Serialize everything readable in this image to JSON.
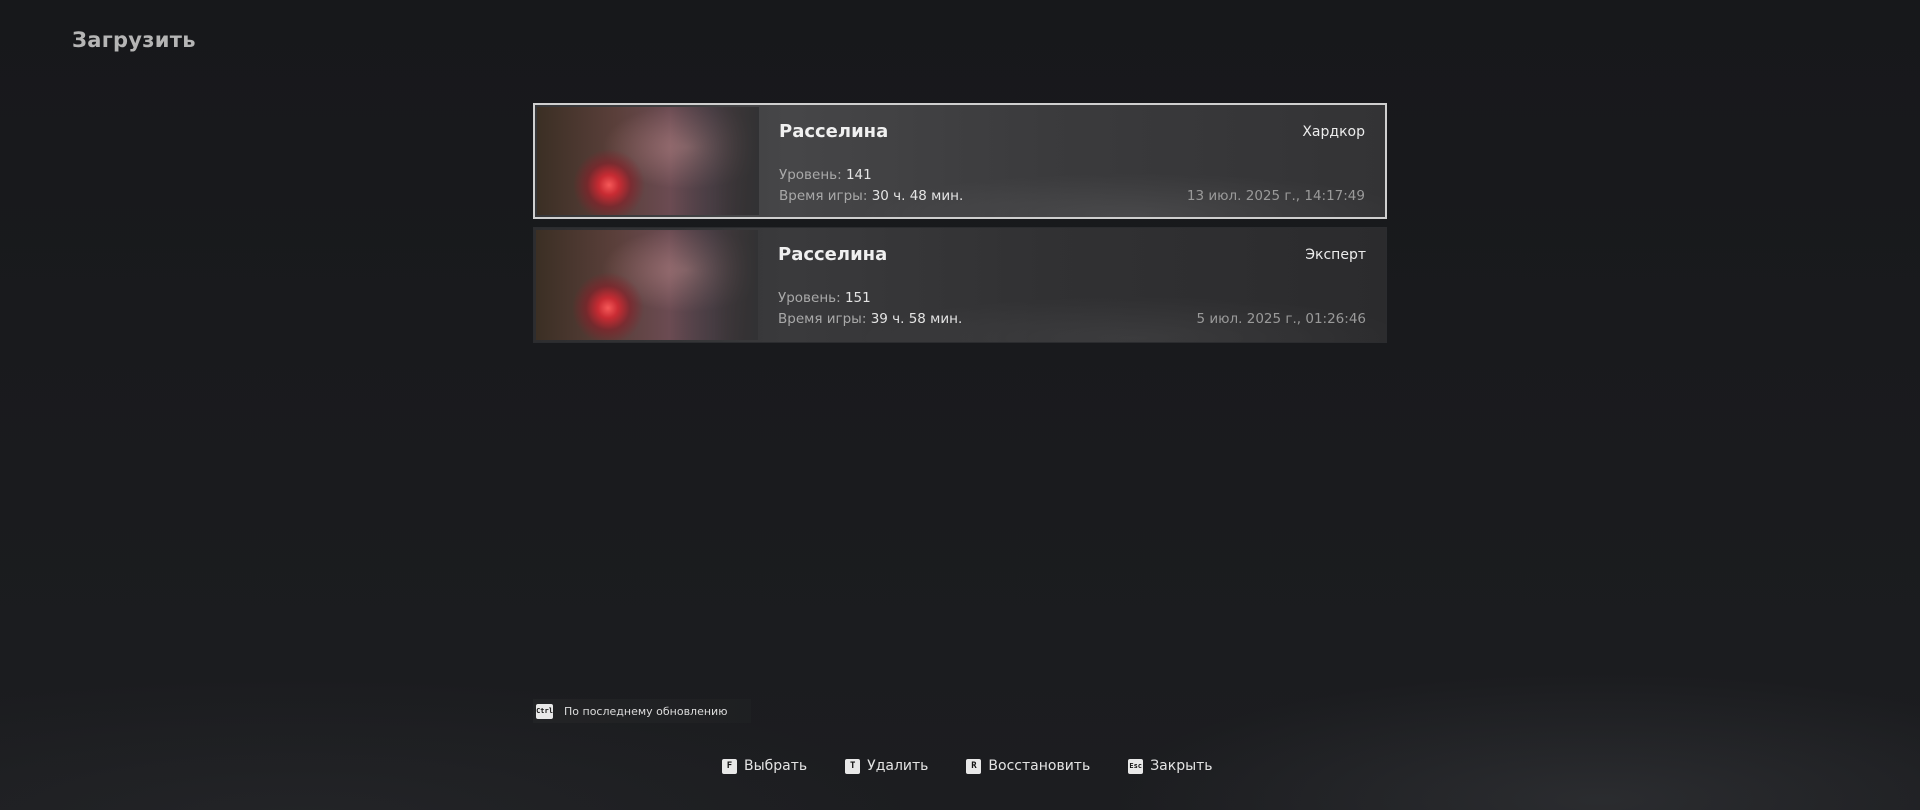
{
  "page": {
    "title": "Загрузить"
  },
  "saves": [
    {
      "name": "Расселина",
      "mode": "Хардкор",
      "level_label": "Уровень:",
      "level_value": "141",
      "time_label": "Время игры:",
      "time_value": "30 ч. 48 мин.",
      "date": "13 июл. 2025 г., 14:17:49",
      "selected": true
    },
    {
      "name": "Расселина",
      "mode": "Эксперт",
      "level_label": "Уровень:",
      "level_value": "151",
      "time_label": "Время игры:",
      "time_value": "39 ч. 58 мин.",
      "date": "5 июл. 2025 г., 01:26:46",
      "selected": false
    }
  ],
  "sort": {
    "key": "Ctrl",
    "label": "По последнему обновлению"
  },
  "actions": [
    {
      "key": "F",
      "label": "Выбрать"
    },
    {
      "key": "T",
      "label": "Удалить"
    },
    {
      "key": "R",
      "label": "Восстановить"
    },
    {
      "key": "Esc",
      "label": "Закрыть"
    }
  ]
}
